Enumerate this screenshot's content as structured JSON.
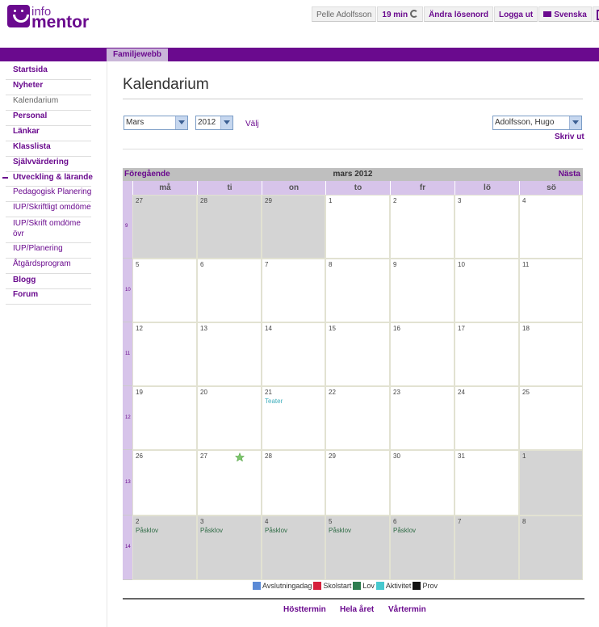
{
  "logo": {
    "line1": "info",
    "line2": "mentor"
  },
  "topbar": {
    "user": "Pelle Adolfsson",
    "session": "19 min",
    "change_password": "Ändra lösenord",
    "logout": "Logga ut",
    "language": "Svenska"
  },
  "tab": {
    "label": "Familjewebb"
  },
  "sidebar": {
    "items": [
      {
        "label": "Startsida"
      },
      {
        "label": "Nyheter"
      },
      {
        "label": "Kalendarium"
      },
      {
        "label": "Personal"
      },
      {
        "label": "Länkar"
      },
      {
        "label": "Klasslista"
      },
      {
        "label": "Självvärdering"
      },
      {
        "label": "Utveckling & lärande"
      },
      {
        "label": "Pedagogisk Planering"
      },
      {
        "label": "IUP/Skriftligt omdöme"
      },
      {
        "label": "IUP/Skrift omdöme övr"
      },
      {
        "label": "IUP/Planering"
      },
      {
        "label": "Åtgärdsprogram"
      },
      {
        "label": "Blogg"
      },
      {
        "label": "Forum"
      }
    ]
  },
  "page": {
    "title": "Kalendarium"
  },
  "filters": {
    "month": "Mars",
    "year": "2012",
    "choose": "Välj",
    "student": "Adolfsson, Hugo",
    "print": "Skriv ut"
  },
  "calendar": {
    "prev": "Föregående",
    "next": "Nästa",
    "month_title": "mars 2012",
    "day_names": [
      "må",
      "ti",
      "on",
      "to",
      "fr",
      "lö",
      "sö"
    ],
    "weeks": [
      {
        "week": "9",
        "days": [
          {
            "n": "27",
            "grey": true
          },
          {
            "n": "28",
            "grey": true
          },
          {
            "n": "29",
            "grey": true
          },
          {
            "n": "1"
          },
          {
            "n": "2"
          },
          {
            "n": "3"
          },
          {
            "n": "4"
          }
        ]
      },
      {
        "week": "10",
        "days": [
          {
            "n": "5"
          },
          {
            "n": "6"
          },
          {
            "n": "7"
          },
          {
            "n": "8"
          },
          {
            "n": "9"
          },
          {
            "n": "10"
          },
          {
            "n": "11"
          }
        ]
      },
      {
        "week": "11",
        "days": [
          {
            "n": "12"
          },
          {
            "n": "13"
          },
          {
            "n": "14"
          },
          {
            "n": "15"
          },
          {
            "n": "16"
          },
          {
            "n": "17"
          },
          {
            "n": "18"
          }
        ]
      },
      {
        "week": "12",
        "days": [
          {
            "n": "19"
          },
          {
            "n": "20"
          },
          {
            "n": "21",
            "event": "Teater",
            "type": "akt"
          },
          {
            "n": "22"
          },
          {
            "n": "23"
          },
          {
            "n": "24"
          },
          {
            "n": "25"
          }
        ]
      },
      {
        "week": "13",
        "days": [
          {
            "n": "26"
          },
          {
            "n": "27",
            "star": true
          },
          {
            "n": "28"
          },
          {
            "n": "29"
          },
          {
            "n": "30"
          },
          {
            "n": "31"
          },
          {
            "n": "1",
            "grey": true
          }
        ]
      },
      {
        "week": "14",
        "days": [
          {
            "n": "2",
            "grey": true,
            "event": "Påsklov",
            "type": "lov"
          },
          {
            "n": "3",
            "grey": true,
            "event": "Påsklov",
            "type": "lov"
          },
          {
            "n": "4",
            "grey": true,
            "event": "Påsklov",
            "type": "lov"
          },
          {
            "n": "5",
            "grey": true,
            "event": "Påsklov",
            "type": "lov"
          },
          {
            "n": "6",
            "grey": true,
            "event": "Påsklov",
            "type": "lov"
          },
          {
            "n": "7",
            "grey": true
          },
          {
            "n": "8",
            "grey": true
          }
        ]
      }
    ],
    "legend": [
      {
        "label": "Avslutningadag",
        "color": "#5b8ad6"
      },
      {
        "label": "Skolstart",
        "color": "#d6203c"
      },
      {
        "label": "Lov",
        "color": "#2e7d4f"
      },
      {
        "label": "Aktivitet",
        "color": "#47c9cf"
      },
      {
        "label": "Prov",
        "color": "#111111"
      }
    ]
  },
  "footer": {
    "autumn": "Hösttermin",
    "full_year": "Hela året",
    "spring": "Vårtermin"
  },
  "colors": {
    "brand": "#6a0a8e",
    "day_header": "#d7c4ea",
    "inactive_cell": "#d4d4d4"
  }
}
